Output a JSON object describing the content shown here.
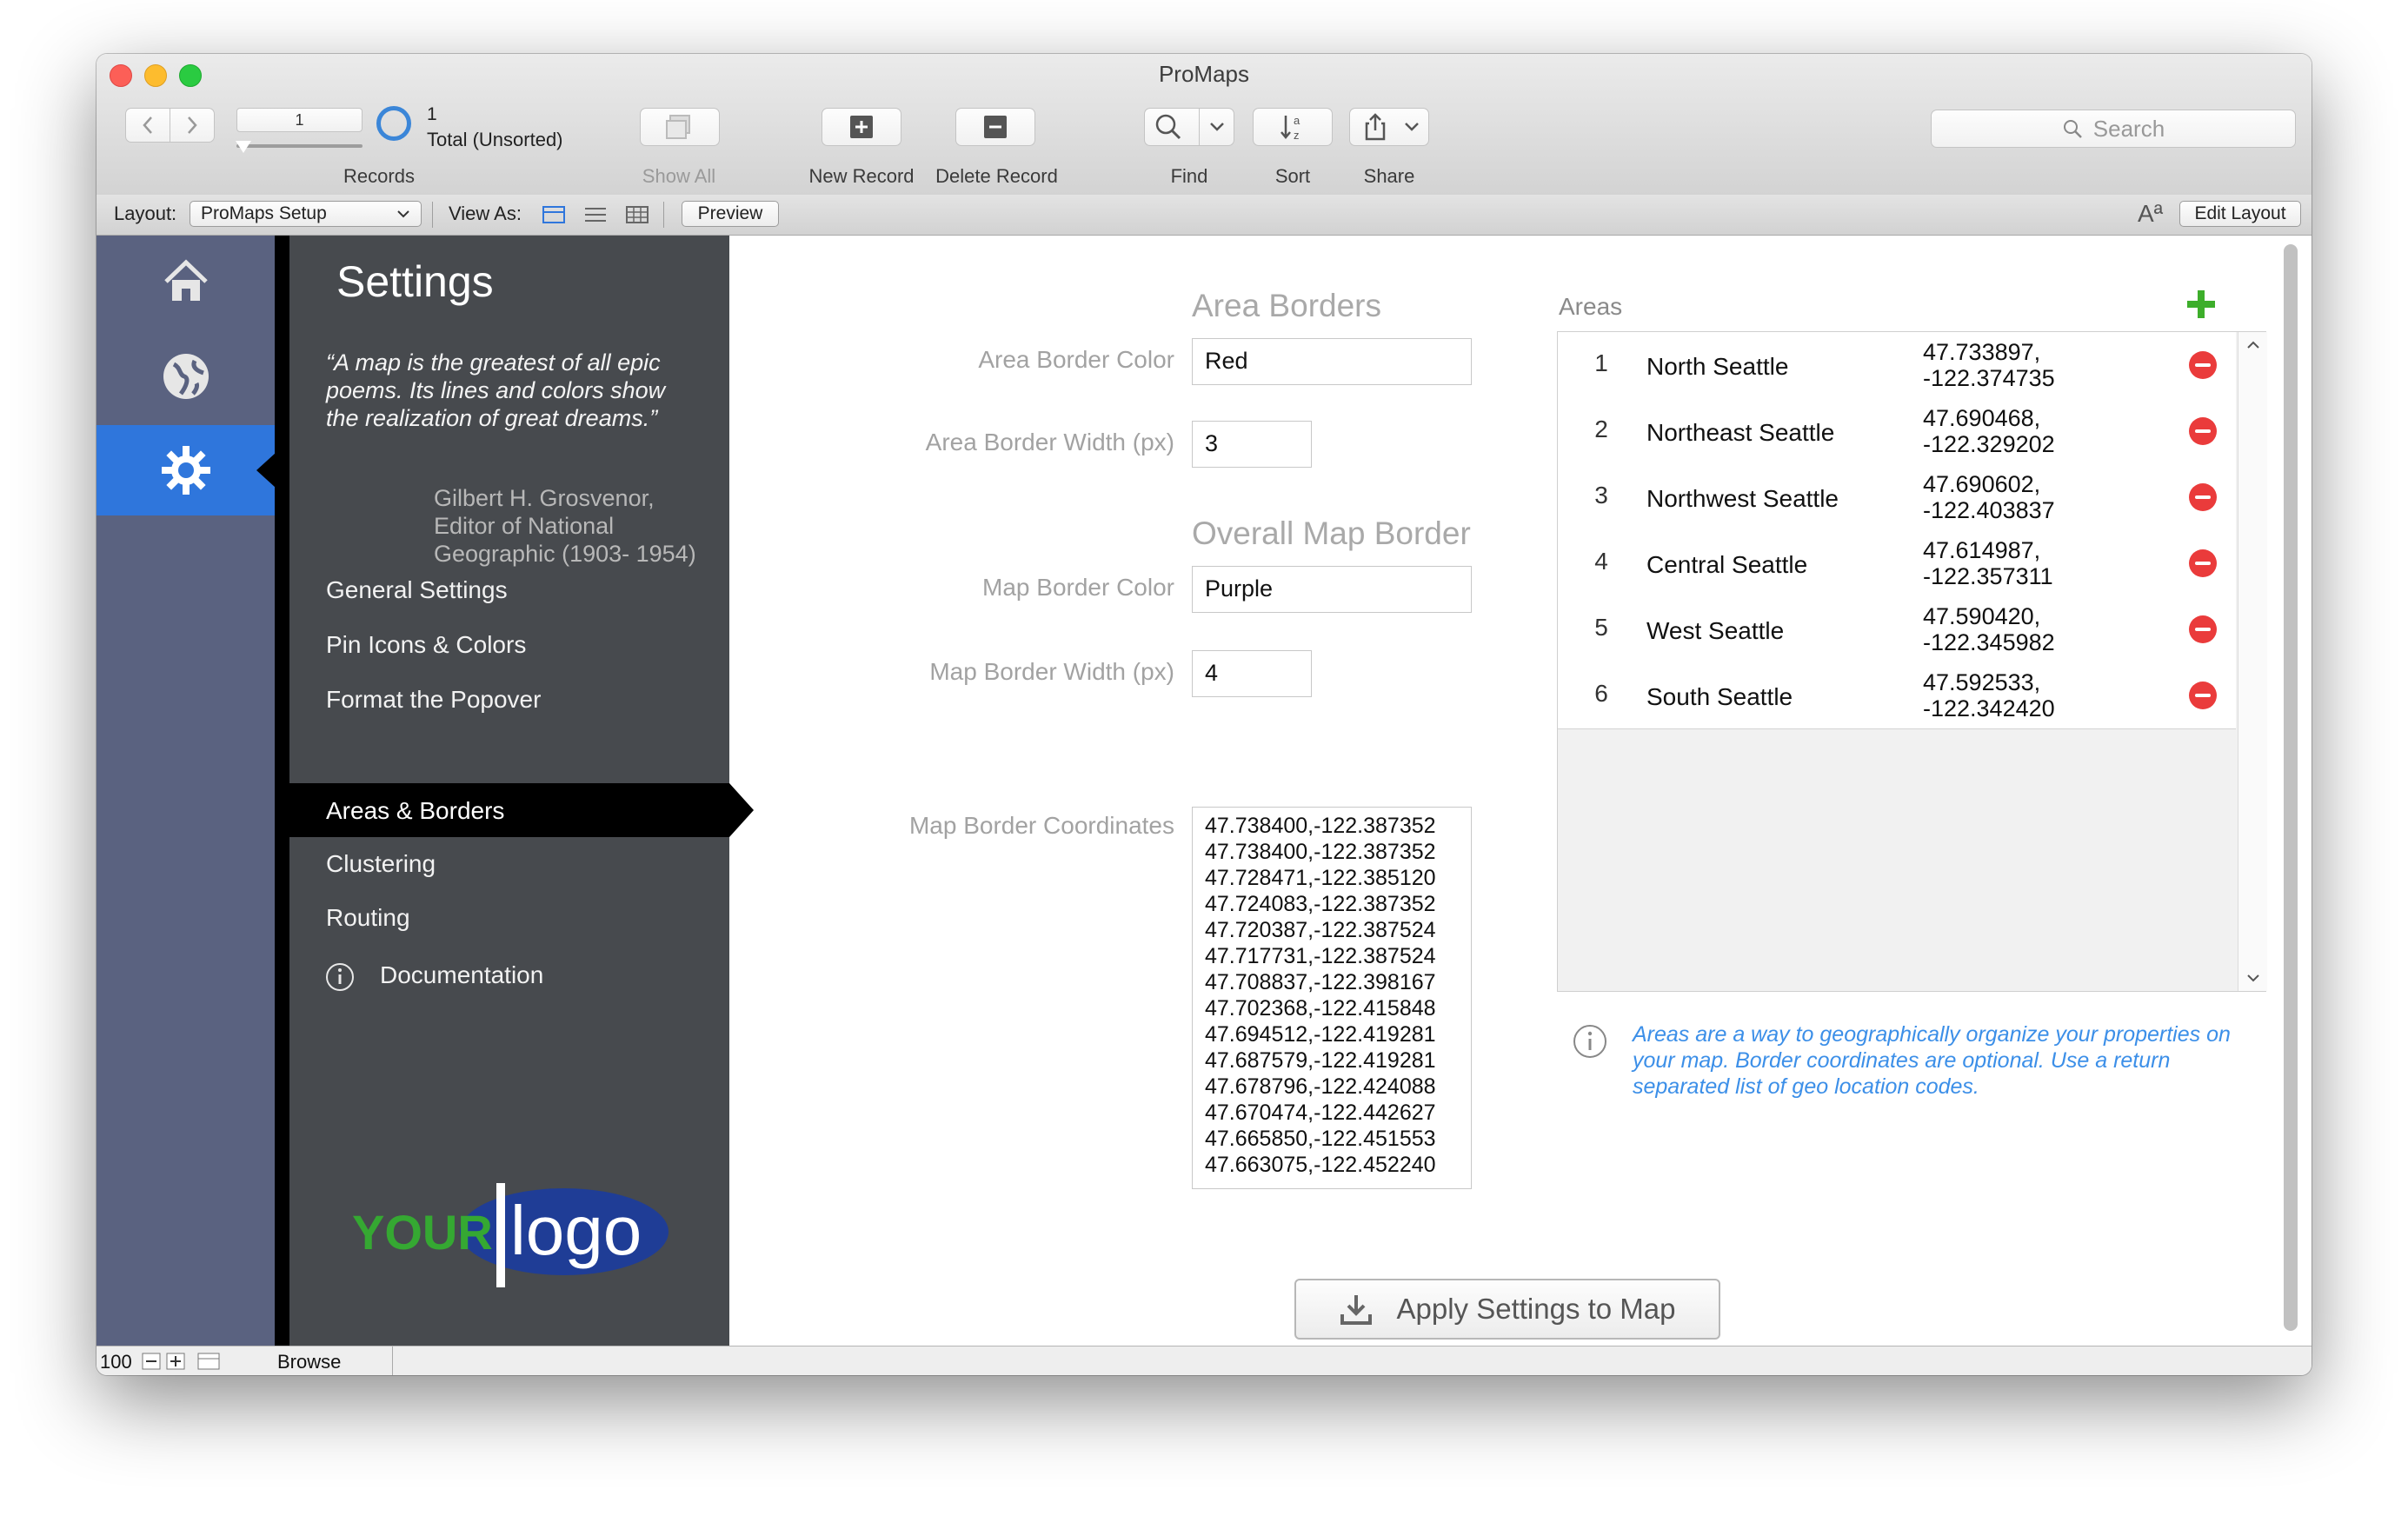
{
  "window": {
    "title": "ProMaps"
  },
  "toolbar": {
    "record_number": "1",
    "records_label": "Records",
    "total_count": "1",
    "total_status": "Total (Unsorted)",
    "show_all": "Show All",
    "new_record": "New Record",
    "delete_record": "Delete Record",
    "find": "Find",
    "sort": "Sort",
    "share": "Share",
    "search_placeholder": "Search"
  },
  "layout_bar": {
    "layout_label": "Layout:",
    "layout_value": "ProMaps Setup",
    "view_as_label": "View As:",
    "preview": "Preview",
    "edit_layout": "Edit Layout"
  },
  "sidebar": {
    "title": "Settings",
    "quote": "“A map is the greatest of all epic poems. Its lines and colors show the realization of great dreams.”",
    "attribution": "Gilbert H. Grosvenor, Editor of National Geographic (1903- 1954)",
    "nav": [
      {
        "label": "General Settings"
      },
      {
        "label": "Pin Icons & Colors"
      },
      {
        "label": "Format the Popover"
      },
      {
        "label": "Areas & Borders"
      },
      {
        "label": "Clustering"
      },
      {
        "label": "Routing"
      },
      {
        "label": "Documentation"
      }
    ],
    "logo_text_your": "YOUR",
    "logo_text_logo": "logo"
  },
  "form": {
    "area_borders_title": "Area Borders",
    "area_border_color_label": "Area Border Color",
    "area_border_color": "Red",
    "area_border_width_label": "Area Border Width (px)",
    "area_border_width": "3",
    "overall_title": "Overall Map Border",
    "map_border_color_label": "Map Border Color",
    "map_border_color": "Purple",
    "map_border_width_label": "Map Border Width (px)",
    "map_border_width": "4",
    "coords_label": "Map Border Coordinates",
    "coordinates": [
      "47.738400,-122.387352",
      "47.738400,-122.387352",
      "47.728471,-122.385120",
      "47.724083,-122.387352",
      "47.720387,-122.387524",
      "47.717731,-122.387524",
      "47.708837,-122.398167",
      "47.702368,-122.415848",
      "47.694512,-122.419281",
      "47.687579,-122.419281",
      "47.678796,-122.424088",
      "47.670474,-122.442627",
      "47.665850,-122.451553",
      "47.663075,-122.452240"
    ]
  },
  "areas": {
    "title": "Areas",
    "rows": [
      {
        "num": "1",
        "name": "North Seattle",
        "lat": "47.733897,",
        "lng": "-122.374735"
      },
      {
        "num": "2",
        "name": "Northeast Seattle",
        "lat": "47.690468,",
        "lng": "-122.329202"
      },
      {
        "num": "3",
        "name": "Northwest Seattle",
        "lat": "47.690602,",
        "lng": "-122.403837"
      },
      {
        "num": "4",
        "name": "Central Seattle",
        "lat": "47.614987,",
        "lng": "-122.357311"
      },
      {
        "num": "5",
        "name": "West Seattle",
        "lat": "47.590420,",
        "lng": "-122.345982"
      },
      {
        "num": "6",
        "name": "South Seattle",
        "lat": "47.592533,",
        "lng": "-122.342420"
      }
    ],
    "info": "Areas are a way to geographically organize your properties on your map. Border coordinates are optional. Use a return separated list of geo location codes."
  },
  "apply_button": "Apply Settings to Map",
  "status_bar": {
    "zoom": "100",
    "mode": "Browse"
  },
  "colors": {
    "accent_blue": "#2f76dc",
    "icon_sidebar": "#5a6280",
    "nav_panel": "#474a4e",
    "delete_red": "#ea3b3b",
    "add_green": "#3dae2b",
    "info_blue": "#3c8fe8"
  }
}
